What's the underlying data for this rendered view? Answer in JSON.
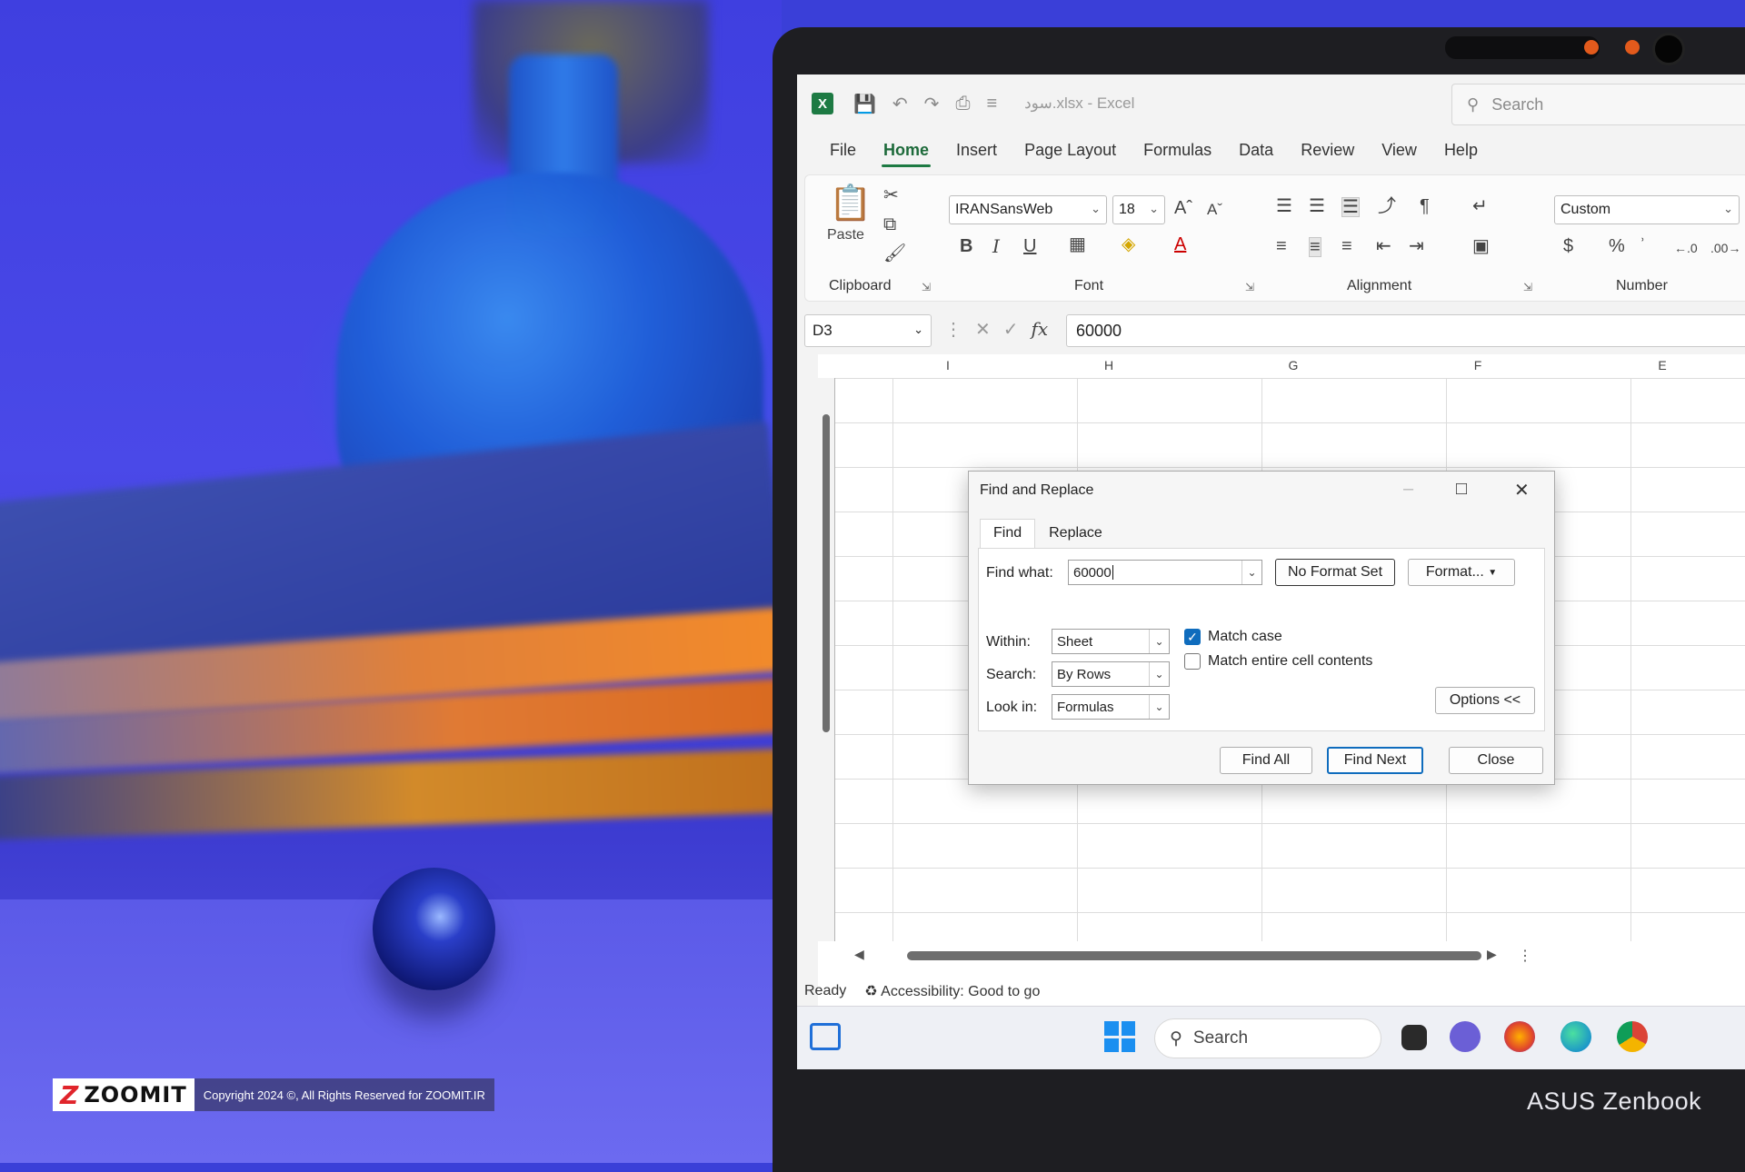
{
  "watermark": {
    "brand": "ZOOMIT",
    "copyright": "Copyright 2024 ©, All Rights Reserved for ZOOMIT.IR"
  },
  "laptop": {
    "brand": "ASUS Zenbook"
  },
  "excel": {
    "title": "سود.xlsx  -  Excel",
    "search_placeholder": "Search",
    "menu": [
      "File",
      "Home",
      "Insert",
      "Page Layout",
      "Formulas",
      "Data",
      "Review",
      "View",
      "Help"
    ],
    "active_menu": "Home",
    "ribbon": {
      "paste_label": "Paste",
      "groups": [
        "Clipboard",
        "Font",
        "Alignment",
        "Number"
      ],
      "font_name": "IRANSansWeb",
      "font_size": "18",
      "number_format": "Custom"
    },
    "name_box": "D3",
    "formula_value": "60000",
    "columns": [
      "I",
      "H",
      "G",
      "F",
      "E"
    ],
    "status": {
      "ready": "Ready",
      "accessibility": "Accessibility: Good to go"
    }
  },
  "dialog": {
    "title": "Find and Replace",
    "tabs": [
      "Find",
      "Replace"
    ],
    "active_tab": "Find",
    "find_what_label": "Find what:",
    "find_what_value": "60000",
    "no_format_label": "No Format Set",
    "format_label": "Format...",
    "within_label": "Within:",
    "within_value": "Sheet",
    "search_label": "Search:",
    "search_value": "By Rows",
    "look_in_label": "Look in:",
    "look_in_value": "Formulas",
    "match_case_label": "Match case",
    "match_case_checked": true,
    "match_entire_label": "Match entire cell contents",
    "match_entire_checked": false,
    "options_label": "Options <<",
    "find_all_label": "Find All",
    "find_next_label": "Find Next",
    "close_label": "Close"
  },
  "taskbar": {
    "search_placeholder": "Search"
  }
}
